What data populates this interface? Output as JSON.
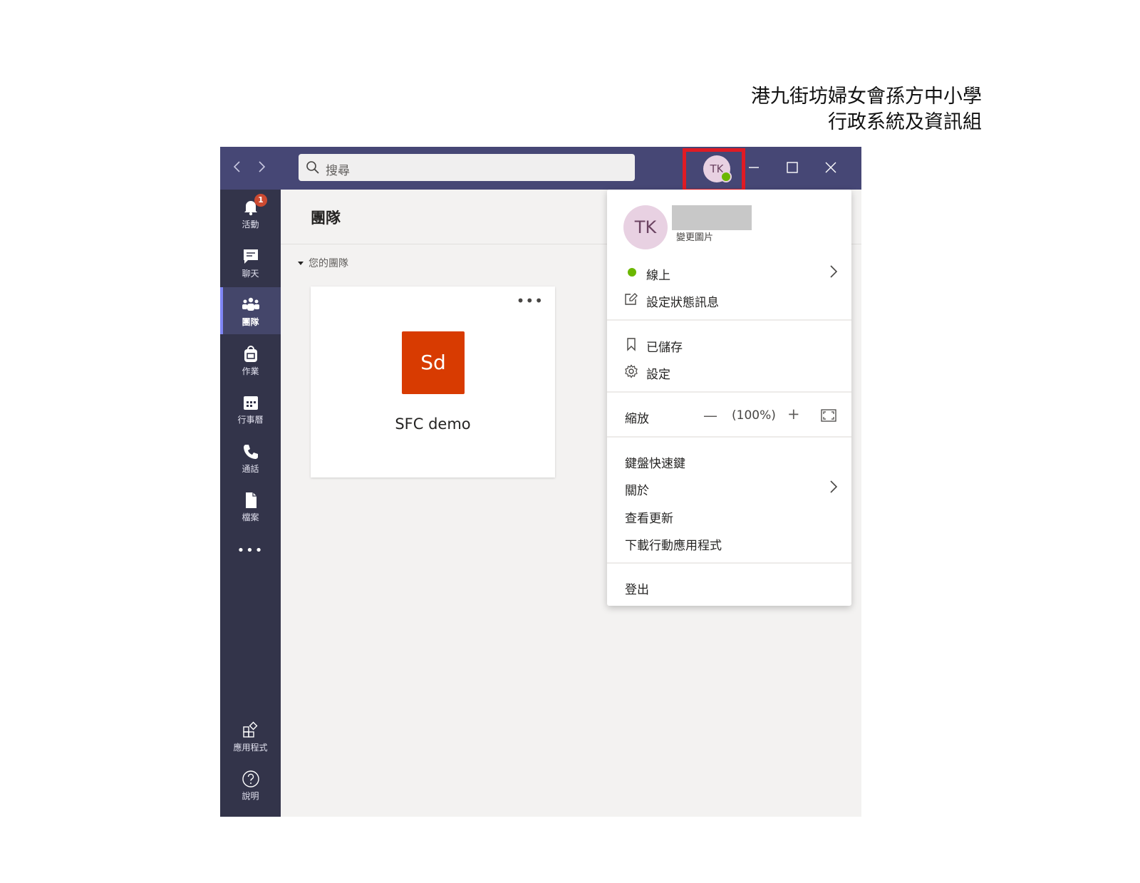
{
  "page_heading": {
    "line1": "港九街坊婦女會孫方中小學",
    "line2": "行政系統及資訊組"
  },
  "titlebar": {
    "back_icon": "chevron-left-icon",
    "forward_icon": "chevron-right-icon",
    "search_placeholder": "搜尋",
    "avatar_initials": "TK",
    "status_color": "#6bb700",
    "highlight_color": "#e01b24",
    "brand_color": "#464775"
  },
  "rail": {
    "items": [
      {
        "label": "活動",
        "icon": "bell-icon",
        "badge": "1"
      },
      {
        "label": "聊天",
        "icon": "chat-icon"
      },
      {
        "label": "團隊",
        "icon": "teams-icon",
        "active": true
      },
      {
        "label": "作業",
        "icon": "backpack-icon"
      },
      {
        "label": "行事曆",
        "icon": "calendar-icon"
      },
      {
        "label": "通話",
        "icon": "phone-icon"
      },
      {
        "label": "檔案",
        "icon": "file-icon"
      }
    ],
    "more": "•••",
    "apps_label": "應用程式",
    "help_label": "說明"
  },
  "main": {
    "title": "團隊",
    "section_label": "您的團隊",
    "team": {
      "initials": "Sd",
      "name": "SFC demo",
      "more": "•••",
      "tile_color": "#d83b01"
    }
  },
  "menu": {
    "avatar_initials": "TK",
    "change_picture": "變更圖片",
    "status": "線上",
    "set_status_message": "設定狀態訊息",
    "saved": "已儲存",
    "settings": "設定",
    "zoom_label": "縮放",
    "zoom_minus": "—",
    "zoom_value": "(100%)",
    "zoom_plus": "+",
    "keyboard_shortcuts": "鍵盤快速鍵",
    "about": "關於",
    "check_updates": "查看更新",
    "download_mobile": "下載行動應用程式",
    "sign_out": "登出"
  }
}
